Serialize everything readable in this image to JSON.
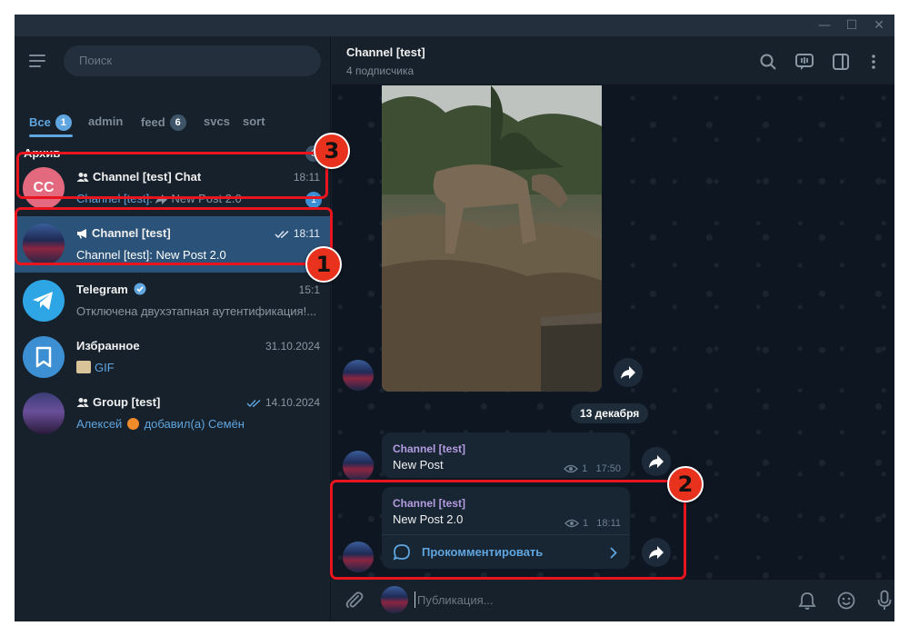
{
  "window": {
    "controls": {
      "minimize": "—",
      "maximize": "☐",
      "close": "✕"
    }
  },
  "sidebar": {
    "search_placeholder": "Поиск",
    "folders": [
      {
        "label": "Все",
        "badge": "1"
      },
      {
        "label": "admin"
      },
      {
        "label": "feed",
        "badge": "6"
      },
      {
        "label": "svcs"
      },
      {
        "label": "sort"
      }
    ],
    "archive": {
      "label": "Архив",
      "count": "6"
    },
    "chats": [
      {
        "name": "Channel [test] Chat",
        "time": "18:11",
        "sender": "Channel [test]:",
        "preview": "New Post 2.0",
        "unread": "1"
      },
      {
        "name": "Channel [test]",
        "time": "18:11",
        "preview": "Channel [test]: New Post 2.0"
      },
      {
        "name": "Telegram",
        "time": "15:1",
        "preview": "Отключена двухэтапная аутентификация!..."
      },
      {
        "name": "Избранное",
        "time": "31.10.2024",
        "preview": "GIF"
      },
      {
        "name": "Group [test]",
        "time": "14.10.2024",
        "sender": "Алексей",
        "preview": "добавил(а) Семён"
      }
    ]
  },
  "main": {
    "header": {
      "title": "Channel [test]",
      "subtitle": "4 подписчика"
    },
    "date_chip": "13 декабря",
    "messages": [
      {
        "author": "Channel [test]",
        "text": "New Post",
        "views": "1",
        "time": "17:50"
      },
      {
        "author": "Channel [test]",
        "text": "New Post 2.0",
        "views": "1",
        "time": "18:11",
        "comment": "Прокомментировать"
      }
    ],
    "composer_placeholder": "Публикация..."
  },
  "annotations": {
    "marker1": "1",
    "marker2": "2",
    "marker3": "3",
    "color": "#e8141e"
  }
}
